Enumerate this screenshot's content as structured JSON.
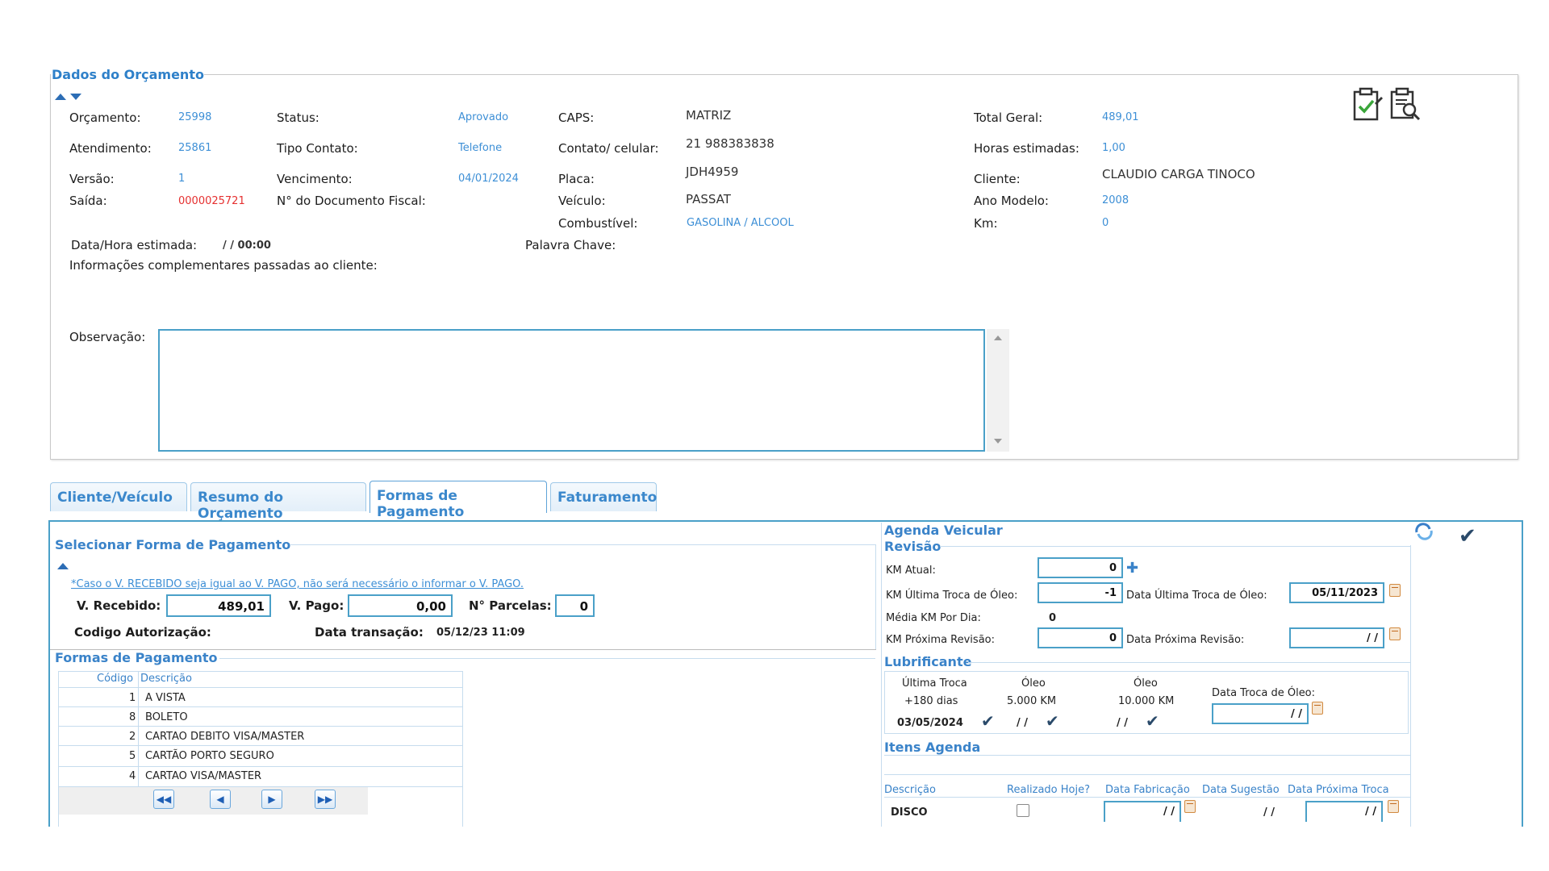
{
  "dados": {
    "legend": "Dados do Orçamento",
    "orcamento_label": "Orçamento:",
    "orcamento": "25998",
    "atendimento_label": "Atendimento:",
    "atendimento": "25861",
    "versao_label": "Versão:",
    "versao": "1",
    "saida_label": "Saída:",
    "saida": "0000025721",
    "status_label": "Status:",
    "status": "Aprovado",
    "tipo_contato_label": "Tipo Contato:",
    "tipo_contato": "Telefone",
    "vencimento_label": "Vencimento:",
    "vencimento": "04/01/2024",
    "doc_fiscal_label": "N° do Documento Fiscal:",
    "caps_label": "CAPS:",
    "caps": "MATRIZ",
    "contato_label": "Contato/ celular:",
    "contato": "21 988383838",
    "placa_label": "Placa:",
    "placa": "JDH4959",
    "veiculo_label": "Veículo:",
    "veiculo": "PASSAT",
    "combustivel_label": "Combustível:",
    "combustivel": "GASOLINA / ALCOOL",
    "total_label": "Total Geral:",
    "total": "489,01",
    "horas_label": "Horas estimadas:",
    "horas": "1,00",
    "cliente_label": "Cliente:",
    "cliente": "CLAUDIO CARGA TINOCO",
    "ano_label": "Ano Modelo:",
    "ano": "2008",
    "km_label": "Km:",
    "km": "0",
    "data_hora_label": "Data/Hora estimada:",
    "data_hora": "/ / 00:00",
    "palavra_label": "Palavra Chave:",
    "info_label": "Informações complementares passadas ao cliente:",
    "obs_label": "Observação:"
  },
  "tabs": [
    {
      "label": "Cliente/Veículo"
    },
    {
      "label": "Resumo do Orçamento"
    },
    {
      "label": "Formas de Pagamento"
    },
    {
      "label": "Faturamento"
    }
  ],
  "pagamento": {
    "heading": "Selecionar Forma de Pagamento",
    "note": "*Caso o V. RECEBIDO seja igual ao V. PAGO, não será necessário o informar o V. PAGO.",
    "recebido_label": "V. Recebido:",
    "recebido": "489,01",
    "pago_label": "V. Pago:",
    "pago": "0,00",
    "parcelas_label": "N° Parcelas:",
    "parcelas": "0",
    "autorizacao_label": "Codigo Autorização:",
    "transacao_label": "Data transação:",
    "transacao": "05/12/23 11:09",
    "formas_heading": "Formas de Pagamento",
    "col_codigo": "Código",
    "col_descricao": "Descrição",
    "rows": [
      {
        "codigo": "1",
        "descricao": "A VISTA"
      },
      {
        "codigo": "8",
        "descricao": "BOLETO"
      },
      {
        "codigo": "2",
        "descricao": "CARTAO DEBITO VISA/MASTER"
      },
      {
        "codigo": "5",
        "descricao": "CARTÃO PORTO SEGURO"
      },
      {
        "codigo": "4",
        "descricao": "CARTAO VISA/MASTER"
      }
    ]
  },
  "agenda": {
    "heading": "Agenda Veicular",
    "revisao": "Revisão",
    "km_atual_label": "KM Atual:",
    "km_atual": "0",
    "km_ultima_label": "KM Última Troca de Óleo:",
    "km_ultima": "-1",
    "data_ultima_label": "Data Última Troca de Óleo:",
    "data_ultima": "05/11/2023",
    "media_label": "Média KM Por Dia:",
    "media": "0",
    "km_proxima_label": "KM Próxima Revisão:",
    "km_proxima": "0",
    "data_proxima_label": "Data Próxima Revisão:",
    "data_proxima": "/ /",
    "lubrificante": "Lubrificante",
    "ultima_troca": "Última Troca",
    "dias": "+180 dias",
    "data_lub": "03/05/2024",
    "oleo1": "Óleo",
    "km5000": "5.000 KM",
    "oleo1_data": "/ /",
    "oleo2": "Óleo",
    "km10000": "10.000 KM",
    "oleo2_data": "/ /",
    "data_troca_label": "Data Troca de Óleo:",
    "data_troca": "/ /",
    "itens": "Itens Agenda",
    "col_desc": "Descrição",
    "col_realizado": "Realizado Hoje?",
    "col_fab": "Data Fabricação",
    "col_sug": "Data Sugestão",
    "col_prox": "Data Próxima Troca",
    "item_desc": "DISCO",
    "item_fab": "/ /",
    "item_sug": "/ /",
    "item_prox": "/ /"
  }
}
